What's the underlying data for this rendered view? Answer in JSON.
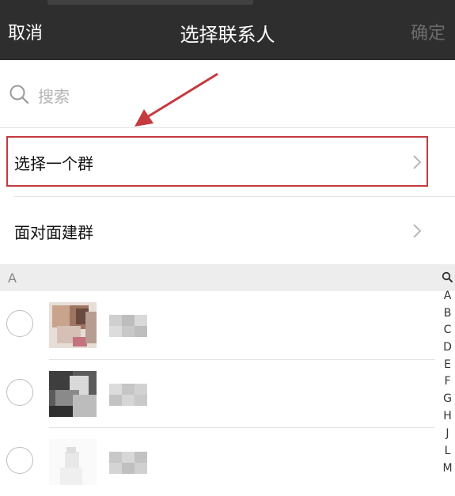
{
  "header": {
    "cancel_label": "取消",
    "title": "选择联系人",
    "confirm_label": "确定"
  },
  "search": {
    "placeholder": "搜索",
    "icon": "search-icon"
  },
  "menu": [
    {
      "label": "选择一个群",
      "icon": "chevron-right-icon",
      "highlighted": true
    },
    {
      "label": "面对面建群",
      "icon": "chevron-right-icon",
      "highlighted": false
    }
  ],
  "section": {
    "letter": "A"
  },
  "index_bar": {
    "letters": [
      "A",
      "B",
      "C",
      "D",
      "E",
      "F",
      "G",
      "H",
      "J",
      "L",
      "M"
    ]
  },
  "colors": {
    "header_bg": "#2e2e2e",
    "annotation_red": "#c43a3f",
    "section_bg": "#ededed"
  }
}
